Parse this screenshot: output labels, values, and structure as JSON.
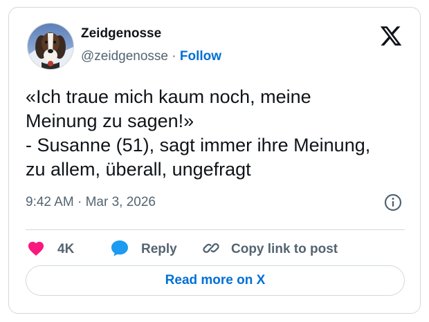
{
  "author": {
    "display_name": "Zeidgenosse",
    "handle": "@zeidgenosse",
    "separator": " · ",
    "follow_label": "Follow"
  },
  "tweet": {
    "lines": [
      "«Ich traue mich kaum noch, meine",
      "Meinung zu sagen!»",
      "- Susanne (51), sagt immer ihre Meinung,",
      "zu allem, überall, ungefragt"
    ],
    "timestamp": "9:42 AM · Mar 3, 2026"
  },
  "actions": {
    "like_count": "4K",
    "reply_label": "Reply",
    "copy_link_label": "Copy link to post"
  },
  "footer": {
    "read_more_label": "Read more on X"
  },
  "icons": {
    "logo": "x-logo-icon",
    "info": "info-icon",
    "like": "heart-icon",
    "reply": "speech-bubble-icon",
    "copy": "link-icon"
  },
  "colors": {
    "accent": "#006fd6",
    "heart": "#f91880",
    "reply_bubble": "#1d9bf0",
    "text": "#0f1419",
    "secondary": "#536471",
    "border": "#cfd9de"
  }
}
